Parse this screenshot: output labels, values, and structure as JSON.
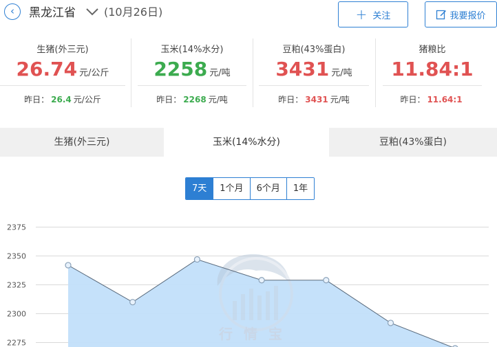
{
  "header": {
    "back_icon": "back-arrow-icon",
    "province": "黑龙江省",
    "date": "(10月26日)",
    "follow_label": "关注",
    "report_label": "我要报价"
  },
  "metrics": [
    {
      "label": "生猪(外三元)",
      "value": "26.74",
      "unit": "元/公斤",
      "prev_label": "昨日：",
      "prev_value": "26.4",
      "prev_unit": "元/公斤",
      "value_color": "#e05252",
      "prev_color": "#3cab4f"
    },
    {
      "label": "玉米(14%水分)",
      "value": "2258",
      "unit": "元/吨",
      "prev_label": "昨日：",
      "prev_value": "2268",
      "prev_unit": "元/吨",
      "value_color": "#3cab4f",
      "prev_color": "#3cab4f"
    },
    {
      "label": "豆粕(43%蛋白)",
      "value": "3431",
      "unit": "元/吨",
      "prev_label": "昨日：",
      "prev_value": "3431",
      "prev_unit": "元/吨",
      "value_color": "#e05252",
      "prev_color": "#e05252"
    },
    {
      "label": "猪粮比",
      "value": "11.84:1",
      "unit": "",
      "prev_label": "昨日：",
      "prev_value": "11.64:1",
      "prev_unit": "",
      "value_color": "#e05252",
      "prev_color": "#e05252"
    }
  ],
  "tabs": [
    {
      "label": "生猪(外三元)",
      "active": false
    },
    {
      "label": "玉米(14%水分)",
      "active": true
    },
    {
      "label": "豆粕(43%蛋白)",
      "active": false
    }
  ],
  "ranges": [
    {
      "label": "7天",
      "selected": true
    },
    {
      "label": "1个月",
      "selected": false
    },
    {
      "label": "6个月",
      "selected": false
    },
    {
      "label": "1年",
      "selected": false
    }
  ],
  "watermark": "行情宝",
  "chart_data": {
    "type": "area",
    "series": [
      {
        "values": [
          2342,
          2310,
          2347,
          2329,
          2329,
          2292,
          2270
        ]
      }
    ],
    "ylim": [
      2270,
      2380
    ],
    "yticks": [
      2375,
      2350,
      2325,
      2300,
      2275
    ],
    "grid": true,
    "fill_color": "#c2dffa",
    "line_color": "#5a6b7d"
  }
}
